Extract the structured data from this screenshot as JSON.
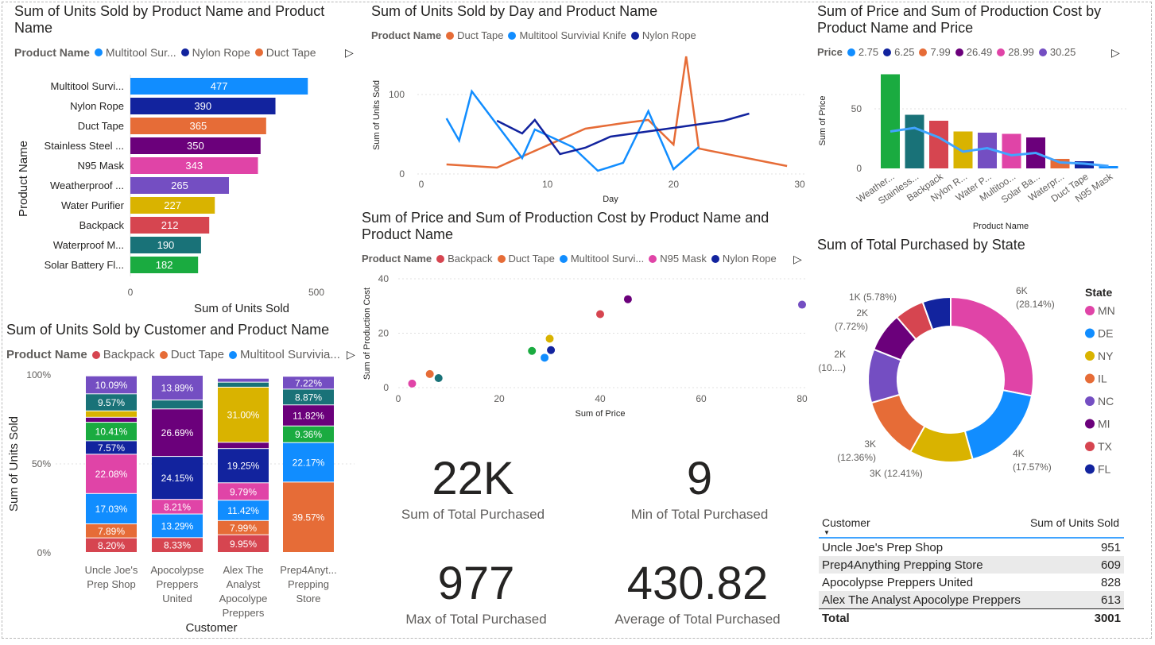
{
  "bar_chart": {
    "title": "Sum of Units Sold by Product Name and Product Name",
    "legend_title": "Product Name",
    "legend": [
      {
        "label": "Multitool Sur...",
        "color": "#118DFF"
      },
      {
        "label": "Nylon Rope",
        "color": "#12239E"
      },
      {
        "label": "Duct Tape",
        "color": "#E66C37"
      }
    ],
    "ylabel": "Product Name",
    "xlabel": "Sum of Units Sold",
    "x_ticks": [
      "0",
      "500"
    ]
  },
  "line_chart": {
    "title": "Sum of Units Sold by Day and Product Name",
    "legend_title": "Product Name",
    "legend": [
      {
        "label": "Duct Tape",
        "color": "#E66C37"
      },
      {
        "label": "Multitool Survivial Knife",
        "color": "#118DFF"
      },
      {
        "label": "Nylon Rope",
        "color": "#12239E"
      }
    ],
    "xlabel": "Day",
    "ylabel": "Sum of Units Sold",
    "x_ticks": [
      "0",
      "10",
      "20",
      "30"
    ],
    "y_ticks": [
      "0",
      "100"
    ]
  },
  "combo_chart": {
    "title": "Sum of Price and Sum of Production Cost by Product Name and Price",
    "legend_title": "Price",
    "legend": [
      {
        "label": "2.75",
        "color": "#118DFF"
      },
      {
        "label": "6.25",
        "color": "#12239E"
      },
      {
        "label": "7.99",
        "color": "#E66C37"
      },
      {
        "label": "26.49",
        "color": "#6B007B"
      },
      {
        "label": "28.99",
        "color": "#E044A7"
      },
      {
        "label": "30.25",
        "color": "#744EC2"
      }
    ],
    "ylabel": "Sum of Price",
    "xlabel": "Product Name",
    "y_ticks": [
      "0",
      "50"
    ]
  },
  "stacked_chart": {
    "title": "Sum of Units Sold by Customer and Product Name",
    "legend_title": "Product Name",
    "legend": [
      {
        "label": "Backpack",
        "color": "#D64550"
      },
      {
        "label": "Duct Tape",
        "color": "#E66C37"
      },
      {
        "label": "Multitool Survivia...",
        "color": "#118DFF"
      }
    ],
    "ylabel": "Sum of Units Sold",
    "xlabel": "Customer",
    "y_ticks": [
      "0%",
      "50%",
      "100%"
    ]
  },
  "scatter_chart": {
    "title": "Sum of Price and Sum of Production Cost by Product Name and Product Name",
    "legend_title": "Product Name",
    "legend": [
      {
        "label": "Backpack",
        "color": "#D64550"
      },
      {
        "label": "Duct Tape",
        "color": "#E66C37"
      },
      {
        "label": "Multitool Survi...",
        "color": "#118DFF"
      },
      {
        "label": "N95 Mask",
        "color": "#E044A7"
      },
      {
        "label": "Nylon Rope",
        "color": "#12239E"
      }
    ],
    "xlabel": "Sum of Price",
    "ylabel": "Sum of Production Cost",
    "x_ticks": [
      "0",
      "20",
      "40",
      "60",
      "80"
    ],
    "y_ticks": [
      "0",
      "20",
      "40"
    ]
  },
  "donut_chart": {
    "title": "Sum of Total Purchased by State",
    "legend_title": "State"
  },
  "cards": [
    {
      "value": "22K",
      "label": "Sum of Total Purchased"
    },
    {
      "value": "9",
      "label": "Min of Total Purchased"
    },
    {
      "value": "977",
      "label": "Max of Total Purchased"
    },
    {
      "value": "430.82",
      "label": "Average of Total Purchased"
    }
  ],
  "table": {
    "headers": [
      "Customer",
      "Sum of Units Sold"
    ],
    "rows": [
      {
        "customer": "Uncle Joe's Prep Shop",
        "units": "951"
      },
      {
        "customer": "Prep4Anything Prepping Store",
        "units": "609"
      },
      {
        "customer": "Apocolypse Preppers United",
        "units": "828"
      },
      {
        "customer": "Alex The Analyst Apocolype Preppers",
        "units": "613"
      }
    ],
    "total_label": "Total",
    "total_value": "3001"
  },
  "chart_data": [
    {
      "type": "bar",
      "title": "Sum of Units Sold by Product Name and Product Name",
      "xlabel": "Sum of Units Sold",
      "ylabel": "Product Name",
      "orientation": "horizontal",
      "xlim": [
        0,
        550
      ],
      "categories": [
        "Multitool Survi...",
        "Nylon Rope",
        "Duct Tape",
        "Stainless Steel ...",
        "N95 Mask",
        "Weatherproof ...",
        "Water Purifier",
        "Backpack",
        "Waterproof M...",
        "Solar Battery Fl..."
      ],
      "values": [
        477,
        390,
        365,
        350,
        343,
        265,
        227,
        212,
        190,
        182
      ],
      "colors": [
        "#118DFF",
        "#12239E",
        "#E66C37",
        "#6B007B",
        "#E044A7",
        "#744EC2",
        "#D9B300",
        "#D64550",
        "#197278",
        "#1AAB40"
      ]
    },
    {
      "type": "line",
      "title": "Sum of Units Sold by Day and Product Name",
      "xlabel": "Day",
      "ylabel": "Sum of Units Sold",
      "xlim": [
        0,
        30
      ],
      "ylim": [
        0,
        150
      ],
      "series": [
        {
          "name": "Duct Tape",
          "color": "#E66C37",
          "points": [
            [
              2,
              12
            ],
            [
              6,
              8
            ],
            [
              13,
              57
            ],
            [
              16,
              64
            ],
            [
              18,
              68
            ],
            [
              20,
              37
            ],
            [
              21,
              148
            ],
            [
              22,
              32
            ],
            [
              29,
              10
            ]
          ]
        },
        {
          "name": "Multitool Survivial Knife",
          "color": "#118DFF",
          "points": [
            [
              2,
              70
            ],
            [
              3,
              42
            ],
            [
              4,
              104
            ],
            [
              8,
              20
            ],
            [
              9,
              56
            ],
            [
              12,
              34
            ],
            [
              14,
              4
            ],
            [
              16,
              14
            ],
            [
              18,
              79
            ],
            [
              20,
              6
            ],
            [
              22,
              34
            ]
          ]
        },
        {
          "name": "Nylon Rope",
          "color": "#12239E",
          "points": [
            [
              6,
              67
            ],
            [
              8,
              51
            ],
            [
              9,
              68
            ],
            [
              11,
              25
            ],
            [
              13,
              33
            ],
            [
              15,
              47
            ],
            [
              20,
              58
            ],
            [
              24,
              67
            ],
            [
              26,
              76
            ]
          ]
        }
      ]
    },
    {
      "type": "bar",
      "title": "Sum of Price and Sum of Production Cost by Product Name and Price",
      "xlabel": "Product Name",
      "ylabel": "Sum of Price",
      "ylim": [
        0,
        85
      ],
      "categories": [
        "Weather...",
        "Stainless...",
        "Backpack",
        "Nylon R...",
        "Water P...",
        "Multitoo...",
        "Solar Ba...",
        "Waterpr...",
        "Duct Tape",
        "N95 Mask"
      ],
      "values": [
        79,
        45,
        40,
        31,
        30,
        29,
        26,
        8,
        6,
        2
      ],
      "colors": [
        "#1AAB40",
        "#197278",
        "#D64550",
        "#D9B300",
        "#744EC2",
        "#E044A7",
        "#6B007B",
        "#E66C37",
        "#12239E",
        "#118DFF"
      ],
      "line_values": [
        31,
        34,
        26,
        14,
        17,
        11,
        13,
        5,
        4,
        2
      ],
      "line_color": "#41A4FF"
    },
    {
      "type": "bar",
      "stacked": true,
      "percent": true,
      "title": "Sum of Units Sold by Customer and Product Name",
      "xlabel": "Customer",
      "ylabel": "Sum of Units Sold",
      "categories": [
        "Uncle Joe's Prep Shop",
        "Apocolypse Preppers United",
        "Alex The Analyst Apocolype Preppers",
        "Prep4Anyt... Prepping Store"
      ],
      "series": [
        {
          "name": "Backpack",
          "color": "#D64550",
          "values": [
            8.2,
            8.33,
            9.95,
            0
          ]
        },
        {
          "name": "Duct Tape",
          "color": "#E66C37",
          "values": [
            7.89,
            0,
            7.99,
            39.57
          ]
        },
        {
          "name": "Multitool Survivia...",
          "color": "#118DFF",
          "values": [
            17.03,
            13.29,
            11.42,
            22.17
          ]
        },
        {
          "color": "#E044A7",
          "values": [
            22.08,
            8.21,
            9.79,
            0
          ]
        },
        {
          "color": "#12239E",
          "values": [
            7.57,
            24.15,
            19.25,
            0
          ]
        },
        {
          "color": "#1AAB40",
          "values": [
            10.41,
            0,
            0,
            9.36
          ]
        },
        {
          "color": "#6B007B",
          "values": [
            2.8,
            26.69,
            3.5,
            11.82
          ]
        },
        {
          "color": "#D9B300",
          "values": [
            3.6,
            0,
            31.0,
            0
          ]
        },
        {
          "color": "#197278",
          "values": [
            9.57,
            5.0,
            2.8,
            8.87
          ]
        },
        {
          "color": "#744EC2",
          "values": [
            10.09,
            13.89,
            2.2,
            7.22
          ]
        }
      ]
    },
    {
      "type": "scatter",
      "title": "Sum of Price and Sum of Production Cost by Product Name and Product Name",
      "xlabel": "Sum of Price",
      "ylabel": "Sum of Production Cost",
      "xlim": [
        0,
        80
      ],
      "ylim": [
        0,
        40
      ],
      "points": [
        {
          "x": 2.75,
          "y": 1.5,
          "color": "#E044A7"
        },
        {
          "x": 6.25,
          "y": 5,
          "color": "#E66C37"
        },
        {
          "x": 7.99,
          "y": 3.5,
          "color": "#197278"
        },
        {
          "x": 26.49,
          "y": 13.5,
          "color": "#1AAB40"
        },
        {
          "x": 28.99,
          "y": 11,
          "color": "#118DFF"
        },
        {
          "x": 30.25,
          "y": 13.8,
          "color": "#12239E"
        },
        {
          "x": 30,
          "y": 18,
          "color": "#D9B300"
        },
        {
          "x": 40,
          "y": 27,
          "color": "#D64550"
        },
        {
          "x": 45.5,
          "y": 32.5,
          "color": "#6B007B"
        },
        {
          "x": 80,
          "y": 30.5,
          "color": "#744EC2"
        }
      ]
    },
    {
      "type": "pie",
      "donut": true,
      "title": "Sum of Total Purchased by State",
      "slices": [
        {
          "label": "MN",
          "value": 28.14,
          "text": "6K\n(28.14%)",
          "color": "#E044A7"
        },
        {
          "label": "DE",
          "value": 17.57,
          "text": "4K\n(17.57%)",
          "color": "#118DFF"
        },
        {
          "label": "NY",
          "value": 12.41,
          "text": "3K (12.41%)",
          "color": "#D9B300"
        },
        {
          "label": "IL",
          "value": 12.36,
          "text": "3K\n(12.36%)",
          "color": "#E66C37"
        },
        {
          "label": "NC",
          "value": 10.5,
          "text": "2K\n(10....)",
          "color": "#744EC2"
        },
        {
          "label": "MI",
          "value": 7.72,
          "text": "2K\n(7.72%)",
          "color": "#6B007B"
        },
        {
          "label": "TX",
          "value": 5.78,
          "text": "1K (5.78%)",
          "color": "#D64550"
        },
        {
          "label": "FL",
          "value": 5.52,
          "text": "",
          "color": "#12239E"
        }
      ]
    }
  ]
}
